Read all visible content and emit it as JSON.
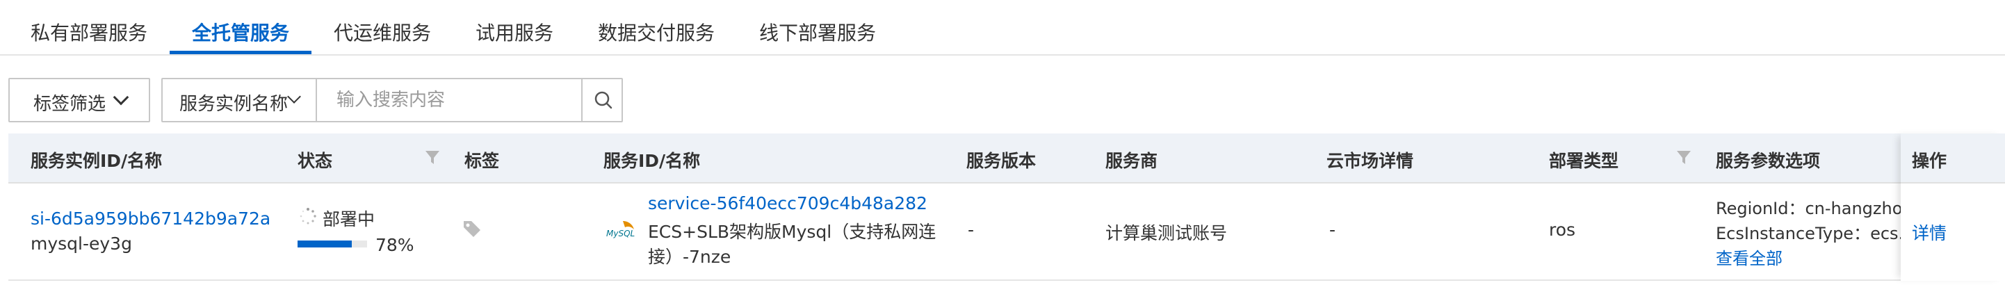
{
  "tabs": [
    {
      "label": "私有部署服务"
    },
    {
      "label": "全托管服务"
    },
    {
      "label": "代运维服务"
    },
    {
      "label": "试用服务"
    },
    {
      "label": "数据交付服务"
    },
    {
      "label": "线下部署服务"
    }
  ],
  "active_tab": "全托管服务",
  "toolbar": {
    "tag_filter_label": "标签筛选",
    "search_field_label": "服务实例名称",
    "search_placeholder": "输入搜索内容"
  },
  "table": {
    "columns": [
      {
        "label": "服务实例ID/名称"
      },
      {
        "label": "状态"
      },
      {
        "label": "标签"
      },
      {
        "label": "服务ID/名称"
      },
      {
        "label": "服务版本"
      },
      {
        "label": "服务商"
      },
      {
        "label": "云市场详情"
      },
      {
        "label": "部署类型"
      },
      {
        "label": "服务参数选项"
      },
      {
        "label": "操作"
      }
    ],
    "rows": [
      {
        "instance_id": "si-6d5a959bb67142b9a72a",
        "instance_name": "mysql-ey3g",
        "status": "部署中",
        "progress_text": "78%",
        "progress": 78,
        "service_id": "service-56f40ecc709c4b48a282",
        "service_name_line1": "ECS+SLB架构版Mysql（支持私网连",
        "service_name_line2": "接）-7nze",
        "service_logo_text": "MySQL",
        "service_version": "-",
        "provider": "计算巢测试账号",
        "marketplace": "-",
        "deploy_type": "ros",
        "param_line1": "RegionId：cn-hangzhou",
        "param_line2": "EcsInstanceType：ecs.c",
        "view_all": "查看全部",
        "action": "详情"
      }
    ]
  },
  "colors": {
    "accent": "#0064c8",
    "header_bg": "#eef2f7",
    "border": "#c7c7c7"
  }
}
